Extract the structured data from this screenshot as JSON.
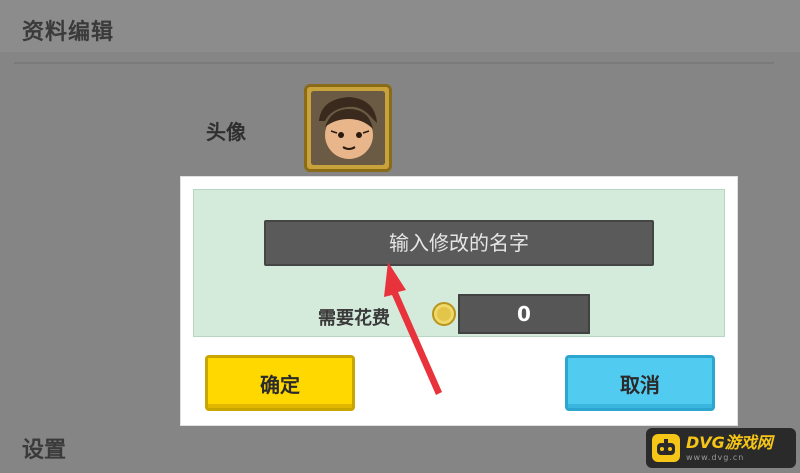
{
  "page": {
    "title": "资料编辑",
    "avatar_label": "头像",
    "settings_label": "设置"
  },
  "rename_dialog": {
    "name_placeholder": "输入修改的名字",
    "cost_label": "需要花费",
    "cost_value": "0",
    "confirm_label": "确定",
    "cancel_label": "取消"
  },
  "watermark": {
    "main": "DVG游戏网",
    "sub": "www.dvg.cn"
  },
  "colors": {
    "overlay_bg": "#858585",
    "panel_bg": "#d4ebdc",
    "confirm_button": "#ffd800",
    "cancel_button": "#52cbf0",
    "arrow": "#e8323c"
  },
  "icons": {
    "coin": "coin-icon",
    "avatar": "avatar-image"
  }
}
